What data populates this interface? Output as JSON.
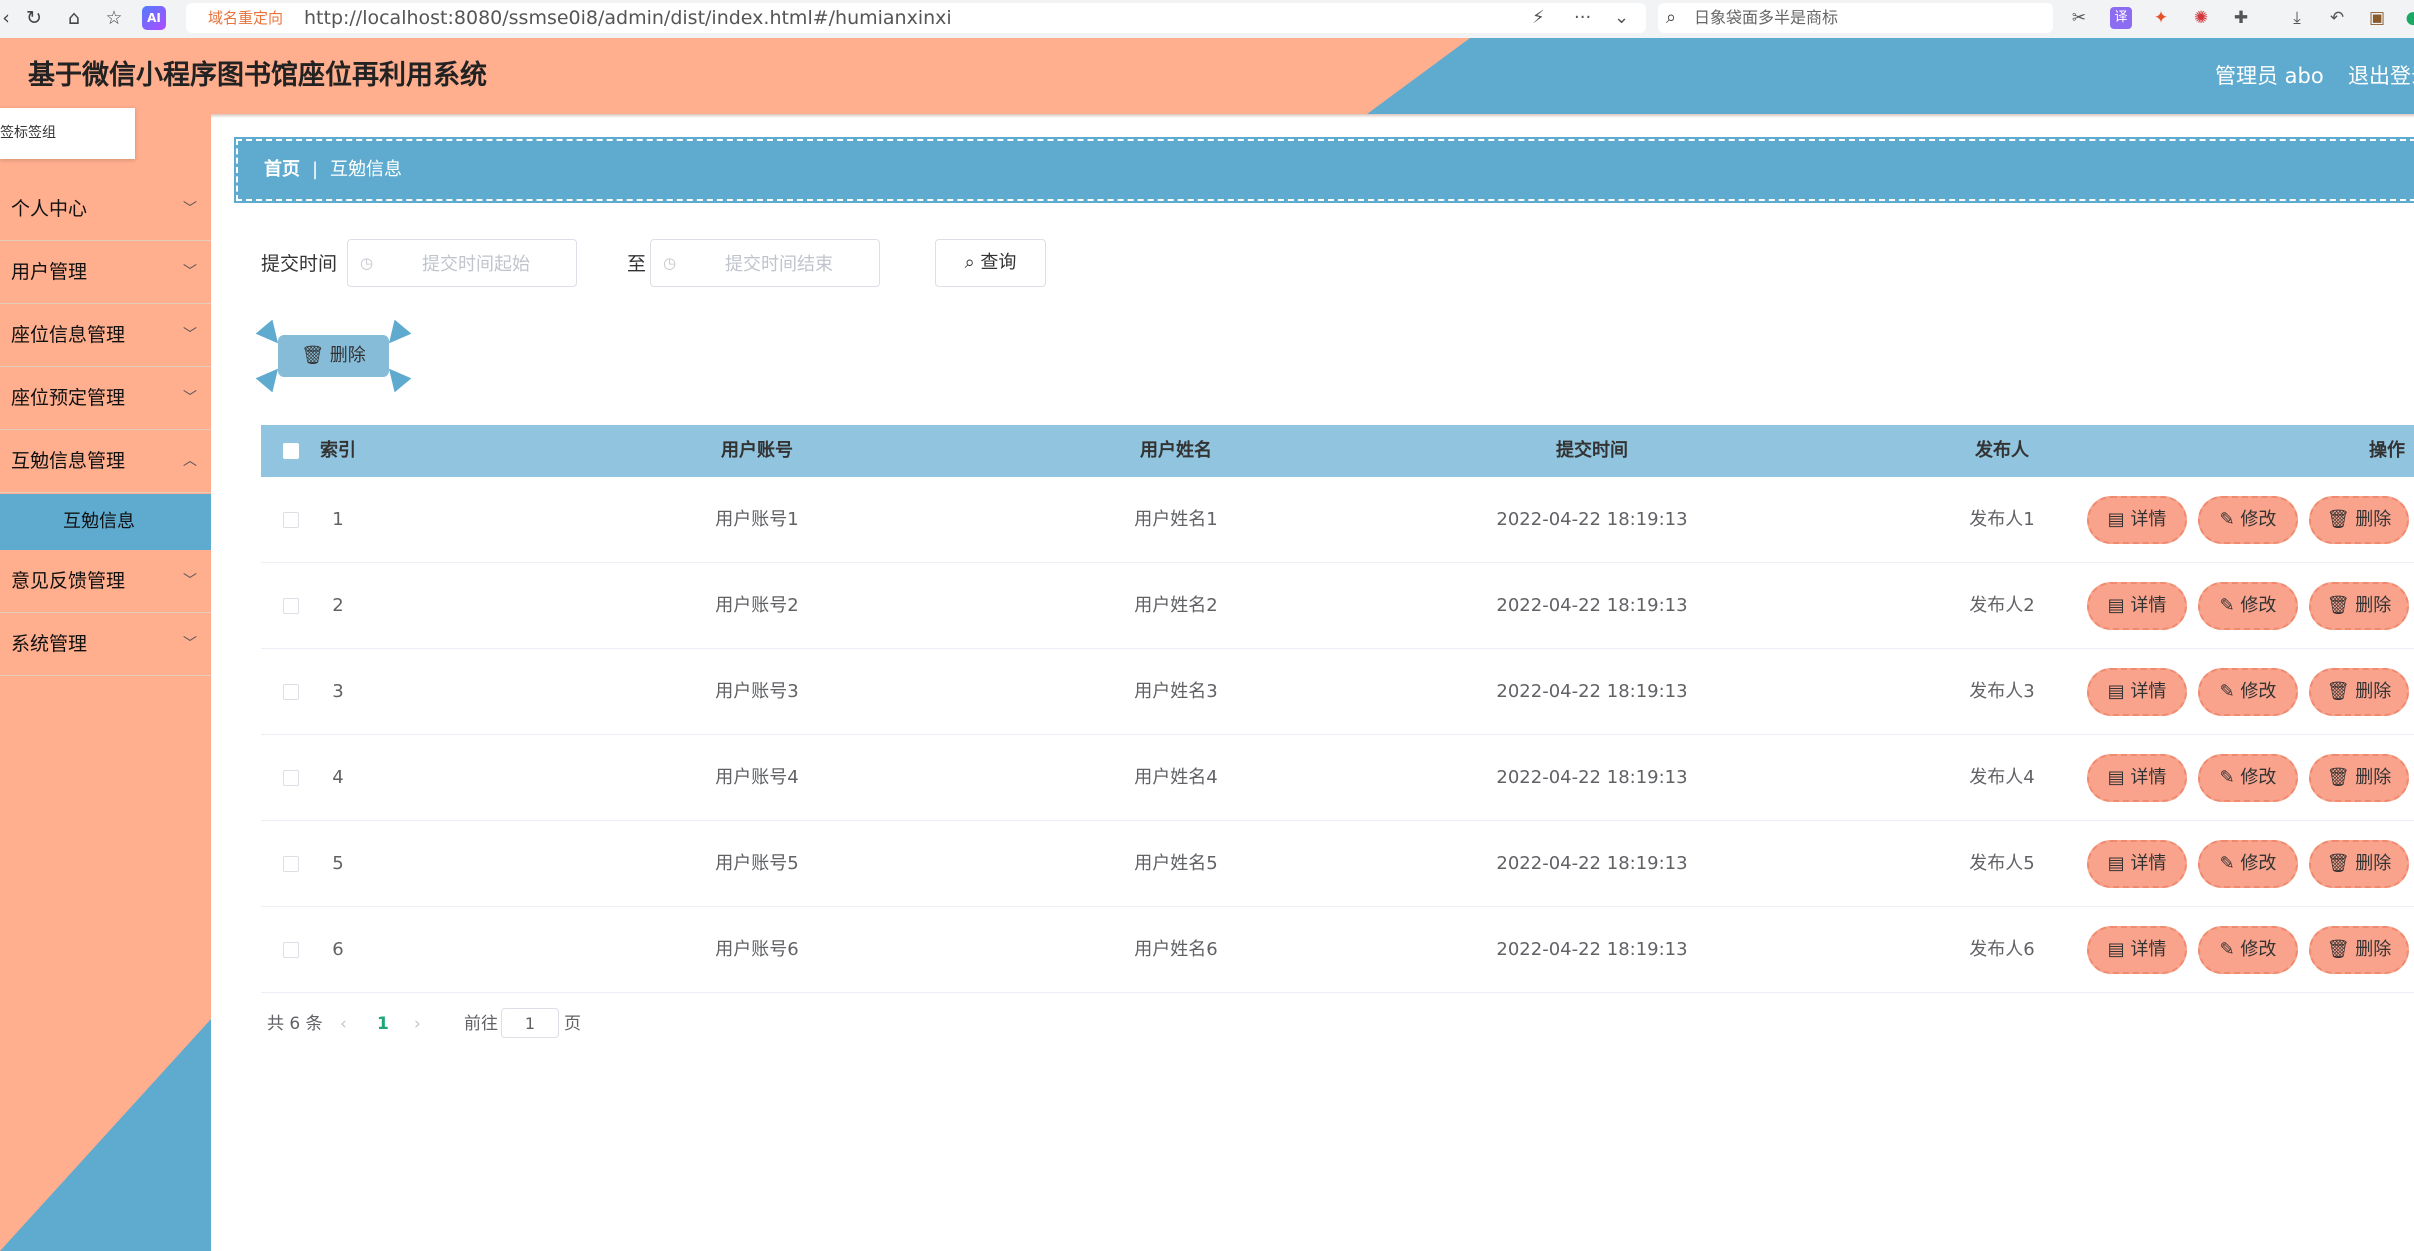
{
  "browser": {
    "redirect_label": "域名重定向",
    "url": "http://localhost:8080/ssmse0i8/admin/dist/index.html#/humianxinxi",
    "search_placeholder": "日象袋面多半是商标",
    "ai_badge": "AI"
  },
  "header": {
    "title": "基于微信小程序图书馆座位再利用系统",
    "admin": "管理员 abo",
    "logout": "退出登录"
  },
  "sidebar": {
    "tooltip": "书签标签组",
    "menu": [
      {
        "label": "个人中心"
      },
      {
        "label": "用户管理"
      },
      {
        "label": "座位信息管理"
      },
      {
        "label": "座位预定管理"
      },
      {
        "label": "互勉信息管理"
      },
      {
        "label": "意见反馈管理"
      },
      {
        "label": "系统管理"
      }
    ],
    "submenu_active": "互勉信息"
  },
  "breadcrumb": {
    "home": "首页",
    "sep": "|",
    "current": "互勉信息"
  },
  "search": {
    "label": "提交时间",
    "start_placeholder": "提交时间起始",
    "to": "至",
    "end_placeholder": "提交时间结束",
    "query_button": "查询"
  },
  "toolbar": {
    "delete_button": "删除"
  },
  "table": {
    "columns": [
      "索引",
      "用户账号",
      "用户姓名",
      "提交时间",
      "发布人",
      "操作"
    ],
    "rows": [
      {
        "index": "1",
        "account": "用户账号1",
        "name": "用户姓名1",
        "time": "2022-04-22 18:19:13",
        "publisher": "发布人1"
      },
      {
        "index": "2",
        "account": "用户账号2",
        "name": "用户姓名2",
        "time": "2022-04-22 18:19:13",
        "publisher": "发布人2"
      },
      {
        "index": "3",
        "account": "用户账号3",
        "name": "用户姓名3",
        "time": "2022-04-22 18:19:13",
        "publisher": "发布人3"
      },
      {
        "index": "4",
        "account": "用户账号4",
        "name": "用户姓名4",
        "time": "2022-04-22 18:19:13",
        "publisher": "发布人4"
      },
      {
        "index": "5",
        "account": "用户账号5",
        "name": "用户姓名5",
        "time": "2022-04-22 18:19:13",
        "publisher": "发布人5"
      },
      {
        "index": "6",
        "account": "用户账号6",
        "name": "用户姓名6",
        "time": "2022-04-22 18:19:13",
        "publisher": "发布人6"
      }
    ],
    "actions": {
      "detail": "详情",
      "edit": "修改",
      "delete": "删除"
    }
  },
  "pagination": {
    "total": "共 6 条",
    "current_page": "1",
    "goto_prefix": "前往",
    "goto_value": "1",
    "goto_suffix": "页"
  },
  "colors": {
    "salmon": "#ffae8e",
    "blue": "#5fabcf",
    "table_header": "#90c4df",
    "action_button": "#f9a38d"
  }
}
